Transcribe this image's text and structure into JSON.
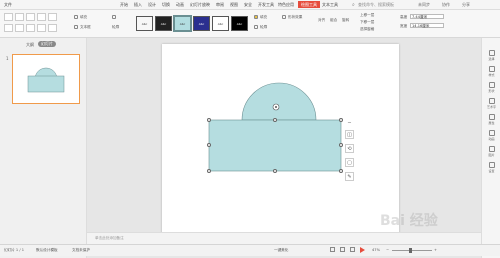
{
  "menu": {
    "items": [
      "文件",
      "开始",
      "插入",
      "设计",
      "切换",
      "动画",
      "幻灯片放映",
      "审阅",
      "视图",
      "安全",
      "开发工具",
      "特色应用",
      "绘图工具",
      "文本工具"
    ],
    "active_index": 12,
    "search_label": "查找命令、搜索模板",
    "right_labels": [
      "未同步",
      "协作",
      "分享"
    ]
  },
  "ribbon": {
    "fill_label": "填充",
    "outline_label": "轮廓",
    "text_box_label": "文本框",
    "style_boxes": [
      "Abc",
      "Abc",
      "Abc",
      "Abc",
      "Abc",
      "Abc"
    ],
    "style_colors": [
      "#ffffff",
      "#222222",
      "#b2dde0",
      "#2b2f8f",
      "#ffffff",
      "#000000"
    ],
    "shape_fill_label": "填充",
    "shape_outline_label": "轮廓",
    "shape_effect_label": "形状效果",
    "arrange_labels": [
      "上移一层",
      "下移一层",
      "选择窗格"
    ],
    "align_label": "对齐",
    "group_label": "组合",
    "rotate_label": "旋转",
    "height_label": "高度",
    "height_value": "7.44厘米",
    "width_label": "宽度",
    "width_value": "14.16厘米"
  },
  "thumbpanel": {
    "tab_outline": "大纲",
    "tab_slides": "幻灯片",
    "slide_number": "1",
    "add_button": "+"
  },
  "notes": {
    "placeholder": "单击此处添加备注"
  },
  "status": {
    "slide_info": "幻灯片 1 / 1",
    "theme": "默认设计模板",
    "doc_protect": "文档未保护",
    "beautify": "一键美化",
    "zoom": "47%",
    "zoom_minus": "−",
    "zoom_plus": "+"
  },
  "rightbar": {
    "items": [
      "选择",
      "样式",
      "形状",
      "艺术字",
      "属性",
      "动画",
      "图片",
      "设置"
    ]
  },
  "watermark": {
    "text": "Bai 经验"
  },
  "shape": {
    "fill_color": "#b5dde0",
    "stroke_color": "#6a8f92"
  },
  "colors": {
    "accent": "#e64c3c",
    "slide_bg": "#ffffff",
    "thumb_border": "#f09a4a"
  }
}
